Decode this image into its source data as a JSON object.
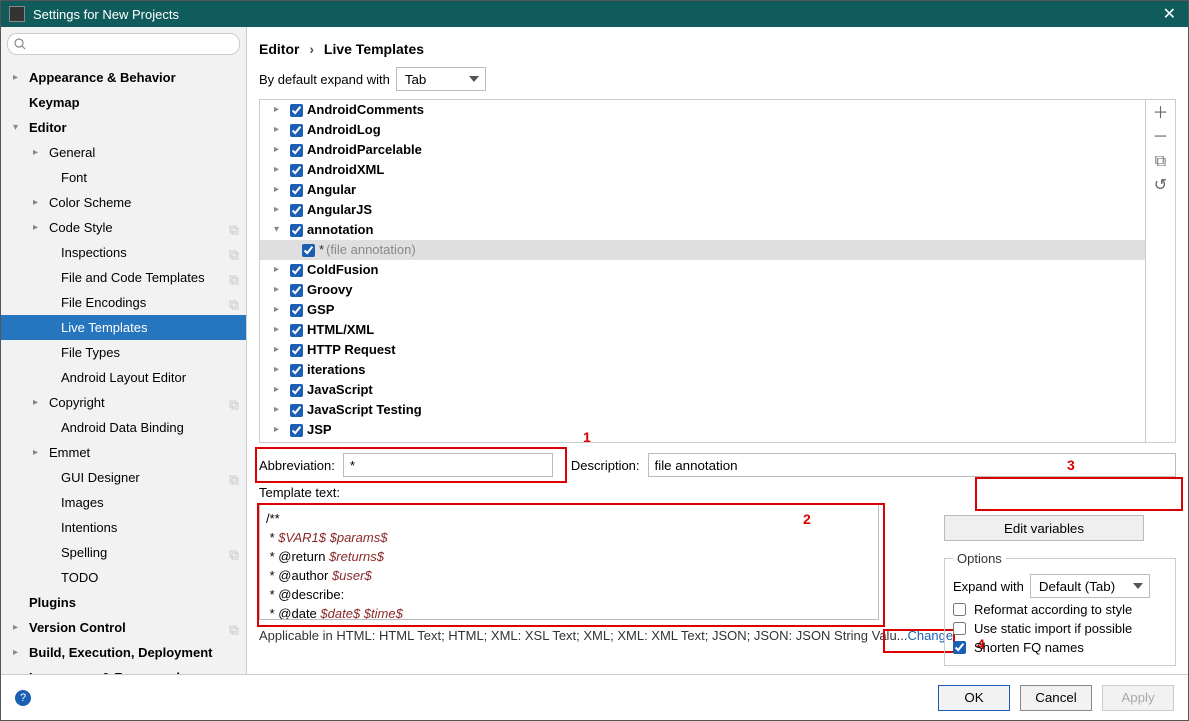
{
  "window": {
    "title": "Settings for New Projects"
  },
  "sidebar": {
    "items": [
      {
        "label": "Appearance & Behavior",
        "bold": true,
        "arrow": "right",
        "level": 1
      },
      {
        "label": "Keymap",
        "bold": true,
        "arrow": "none",
        "level": 1
      },
      {
        "label": "Editor",
        "bold": true,
        "arrow": "down",
        "level": 1
      },
      {
        "label": "General",
        "arrow": "right",
        "level": 2
      },
      {
        "label": "Font",
        "arrow": "none",
        "level": 3
      },
      {
        "label": "Color Scheme",
        "arrow": "right",
        "level": 2
      },
      {
        "label": "Code Style",
        "arrow": "right",
        "level": 2,
        "copy": true
      },
      {
        "label": "Inspections",
        "arrow": "none",
        "level": 3,
        "copy": true
      },
      {
        "label": "File and Code Templates",
        "arrow": "none",
        "level": 3,
        "copy": true
      },
      {
        "label": "File Encodings",
        "arrow": "none",
        "level": 3,
        "copy": true
      },
      {
        "label": "Live Templates",
        "arrow": "none",
        "level": 3,
        "selected": true
      },
      {
        "label": "File Types",
        "arrow": "none",
        "level": 3
      },
      {
        "label": "Android Layout Editor",
        "arrow": "none",
        "level": 3
      },
      {
        "label": "Copyright",
        "arrow": "right",
        "level": 2,
        "copy": true
      },
      {
        "label": "Android Data Binding",
        "arrow": "none",
        "level": 3
      },
      {
        "label": "Emmet",
        "arrow": "right",
        "level": 2
      },
      {
        "label": "GUI Designer",
        "arrow": "none",
        "level": 3,
        "copy": true
      },
      {
        "label": "Images",
        "arrow": "none",
        "level": 3
      },
      {
        "label": "Intentions",
        "arrow": "none",
        "level": 3
      },
      {
        "label": "Spelling",
        "arrow": "none",
        "level": 3,
        "copy": true
      },
      {
        "label": "TODO",
        "arrow": "none",
        "level": 3
      },
      {
        "label": "Plugins",
        "bold": true,
        "arrow": "none",
        "level": 1
      },
      {
        "label": "Version Control",
        "bold": true,
        "arrow": "right",
        "level": 1,
        "copy": true
      },
      {
        "label": "Build, Execution, Deployment",
        "bold": true,
        "arrow": "right",
        "level": 1
      },
      {
        "label": "Languages & Frameworks",
        "bold": true,
        "arrow": "right",
        "level": 1
      }
    ]
  },
  "breadcrumb": {
    "a": "Editor",
    "b": "Live Templates"
  },
  "expand": {
    "label": "By default expand with",
    "value": "Tab"
  },
  "groups": [
    {
      "name": "AndroidComments",
      "arrow": "right"
    },
    {
      "name": "AndroidLog",
      "arrow": "right"
    },
    {
      "name": "AndroidParcelable",
      "arrow": "right"
    },
    {
      "name": "AndroidXML",
      "arrow": "right"
    },
    {
      "name": "Angular",
      "arrow": "right"
    },
    {
      "name": "AngularJS",
      "arrow": "right"
    },
    {
      "name": "annotation",
      "arrow": "down",
      "child": {
        "name": "*",
        "desc": "(file annotation)"
      },
      "selrow": true
    },
    {
      "name": "ColdFusion",
      "arrow": "right"
    },
    {
      "name": "Groovy",
      "arrow": "right"
    },
    {
      "name": "GSP",
      "arrow": "right"
    },
    {
      "name": "HTML/XML",
      "arrow": "right"
    },
    {
      "name": "HTTP Request",
      "arrow": "right"
    },
    {
      "name": "iterations",
      "arrow": "right"
    },
    {
      "name": "JavaScript",
      "arrow": "right"
    },
    {
      "name": "JavaScript Testing",
      "arrow": "right"
    },
    {
      "name": "JSP",
      "arrow": "right"
    }
  ],
  "form": {
    "abbrev_label": "Abbreviation:",
    "abbrev_value": "*",
    "desc_label": "Description:",
    "desc_value": "file annotation",
    "template_label": "Template text:",
    "template_lines": [
      {
        "pre": "/**"
      },
      {
        "pre": " * ",
        "kw": "$VAR1$ $params$"
      },
      {
        "pre": " * @return ",
        "kw": "$returns$"
      },
      {
        "pre": " * @author ",
        "kw": "$user$"
      },
      {
        "pre": " * @describe:"
      },
      {
        "pre": " * @date ",
        "kw": "$date$ $time$"
      }
    ],
    "edit_vars": "Edit variables"
  },
  "options": {
    "legend": "Options",
    "expand_label": "Expand with",
    "expand_value": "Default (Tab)",
    "reformat": "Reformat according to style",
    "static_import": "Use static import if possible",
    "shorten": "Shorten FQ names"
  },
  "applicable": {
    "text": "Applicable in HTML: HTML Text; HTML; XML: XSL Text; XML; XML: XML Text; JSON; JSON: JSON String Valu...",
    "link": "Change"
  },
  "annotations": {
    "n1": "1",
    "n2": "2",
    "n3": "3",
    "n4": "4"
  },
  "footer": {
    "ok": "OK",
    "cancel": "Cancel",
    "apply": "Apply"
  }
}
